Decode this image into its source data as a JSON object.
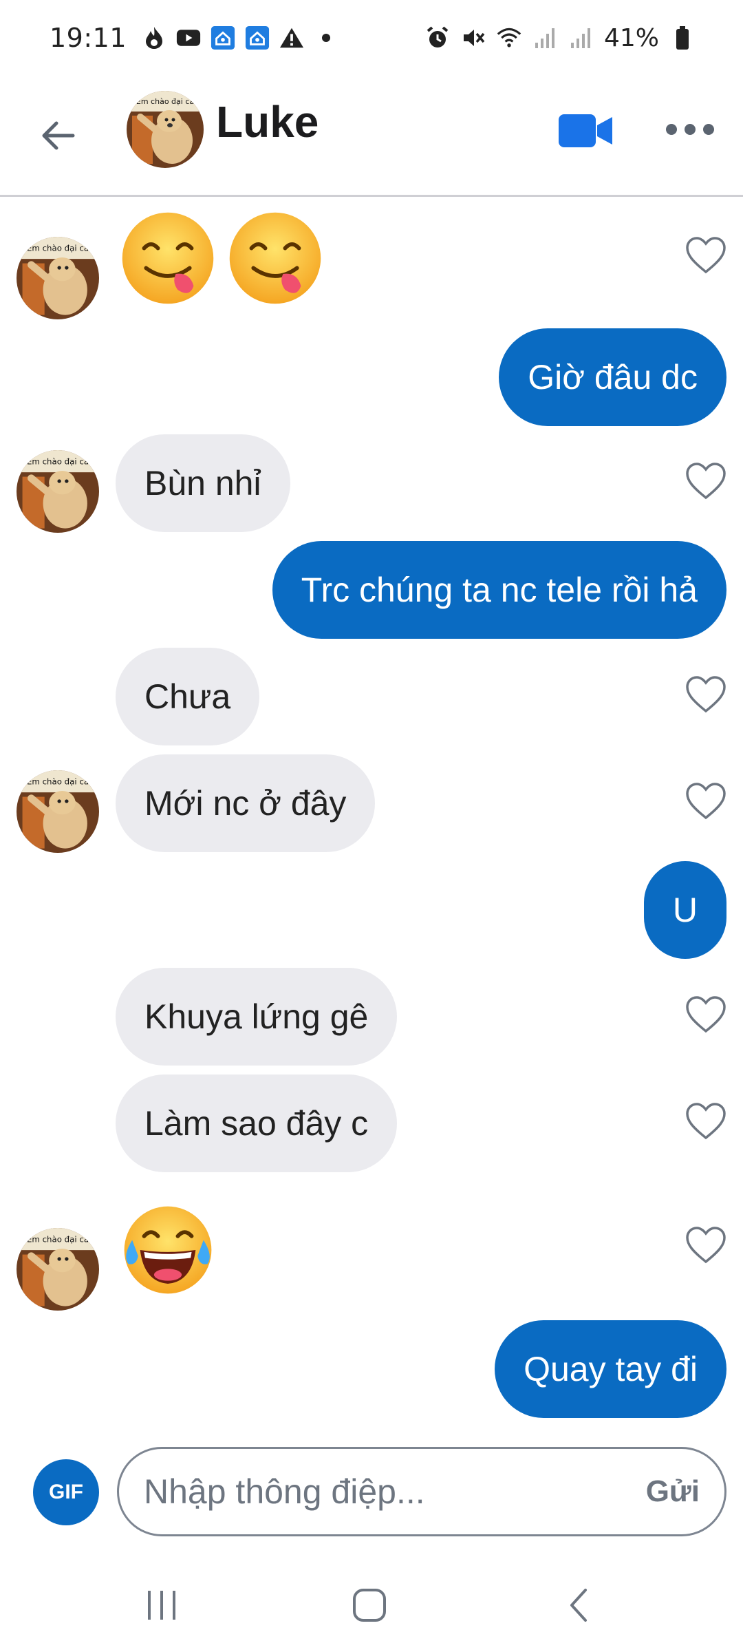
{
  "status_bar": {
    "time": "19:11",
    "battery_text": "41%",
    "left_icons": [
      "flame-icon",
      "youtube-icon",
      "home-app-icon",
      "home-app-icon",
      "warning-icon",
      "dot-icon"
    ],
    "right_icons": [
      "alarm-icon",
      "mute-icon",
      "wifi-icon",
      "signal-icon",
      "signal-icon",
      "battery-icon"
    ]
  },
  "header": {
    "contact_name": "Luke",
    "avatar_caption": "Em chào đại ca",
    "accent_color": "#0a6bc2"
  },
  "messages": [
    {
      "side": "in",
      "type": "emoji",
      "content": "😋😋",
      "emoji_names": [
        "yum-emoji",
        "yum-emoji"
      ],
      "avatar": true
    },
    {
      "side": "out",
      "type": "text",
      "text": "Giờ đâu dc"
    },
    {
      "side": "in",
      "type": "text",
      "text": "Bùn nhỉ",
      "avatar": true
    },
    {
      "side": "out",
      "type": "text",
      "text": "Trc chúng ta nc tele rồi hả"
    },
    {
      "side": "in",
      "type": "text",
      "text": "Chưa",
      "avatar": false
    },
    {
      "side": "in",
      "type": "text",
      "text": "Mới nc ở đây",
      "avatar": true
    },
    {
      "side": "out",
      "type": "text",
      "text": "U"
    },
    {
      "side": "in",
      "type": "text",
      "text": "Khuya lứng gê",
      "avatar": false
    },
    {
      "side": "in",
      "type": "text",
      "text": "Làm sao đây c",
      "avatar": false
    },
    {
      "side": "in",
      "type": "emoji",
      "content": "😂",
      "emoji_names": [
        "tears-of-joy-emoji"
      ],
      "avatar": true
    },
    {
      "side": "out",
      "type": "text",
      "text": "Quay tay đi"
    }
  ],
  "composer": {
    "gif_label": "GIF",
    "placeholder": "Nhập thông điệp...",
    "value": "",
    "send_label": "Gửi"
  },
  "colors": {
    "outgoing_bubble": "#0a6bc2",
    "incoming_bubble": "#ebebef",
    "video_icon": "#1a73e8"
  }
}
